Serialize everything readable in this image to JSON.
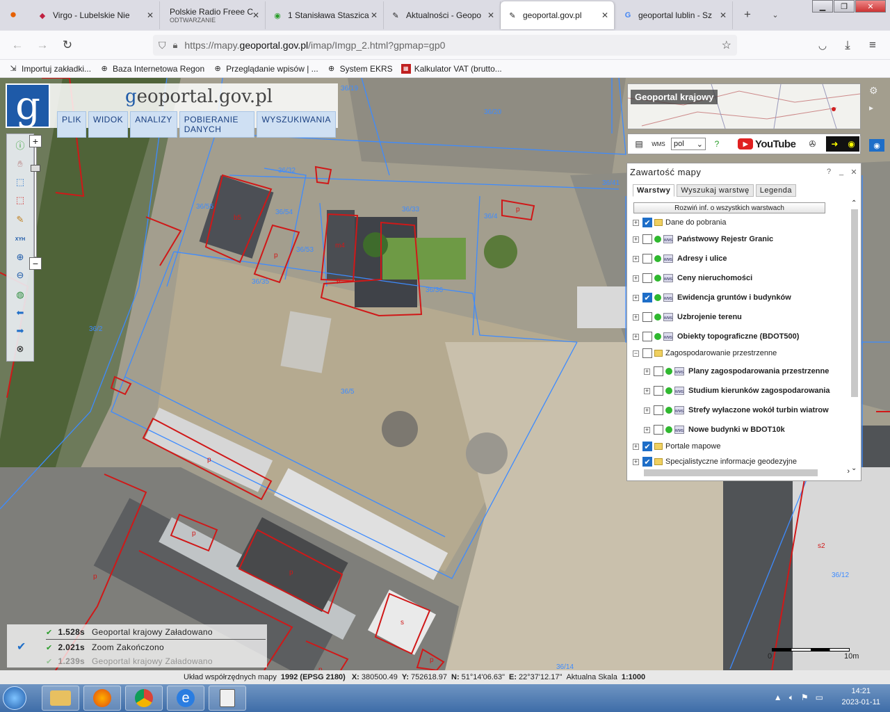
{
  "browser": {
    "tabs": [
      {
        "title": "Virgo - Lubelskie Nie",
        "icon": "virgo-icon"
      },
      {
        "title": "Polskie Radio Freee C",
        "subtitle": "ODTWARZANIE",
        "icon": ""
      },
      {
        "title": "1 Stanisława Staszica",
        "icon": "map-pin-icon"
      },
      {
        "title": "Aktualności - Geopo",
        "icon": "geoportal-icon"
      },
      {
        "title": "geoportal.gov.pl",
        "icon": "geoportal-icon"
      },
      {
        "title": "geoportal lublin - Sz",
        "icon": "google-icon"
      }
    ],
    "url_prefix": "https://mapy.",
    "url_domain": "geoportal.gov.pl",
    "url_suffix": "/imap/Imgp_2.html?gpmap=gp0",
    "bookmarks": [
      {
        "label": "Importuj zakładki...",
        "icon": "import-icon"
      },
      {
        "label": "Baza Internetowa Regon",
        "icon": "globe-icon"
      },
      {
        "label": "Przeglądanie wpisów | ...",
        "icon": "globe-icon"
      },
      {
        "label": "System EKRS",
        "icon": "globe-icon"
      },
      {
        "label": "Kalkulator VAT (brutto...",
        "icon": "vat-icon"
      }
    ]
  },
  "app": {
    "brand_prefix": "g",
    "brand_rest": "eoportal.gov.pl",
    "menu": [
      "PLIK",
      "WIDOK",
      "ANALIZY",
      "POBIERANIE DANYCH",
      "WYSZUKIWANIA"
    ],
    "minimap_label": "Geoportal krajowy",
    "language": "pol",
    "youtube_label": "YouTube"
  },
  "panel": {
    "title": "Zawartość mapy",
    "tabs": [
      "Warstwy",
      "Wyszukaj warstwę",
      "Legenda"
    ],
    "expand_label": "Rozwiń inf. o wszystkich warstwach",
    "layers": [
      {
        "label": "Dane do pobrania",
        "checked": true,
        "type": "folder",
        "indent": 0,
        "toggle": "+"
      },
      {
        "label": "Państwowy Rejestr Granic",
        "checked": false,
        "type": "wms",
        "indent": 0,
        "toggle": "+"
      },
      {
        "label": "Adresy i ulice",
        "checked": false,
        "type": "wms",
        "indent": 0,
        "toggle": "+"
      },
      {
        "label": "Ceny nieruchomości",
        "checked": false,
        "type": "wms",
        "indent": 0,
        "toggle": "+"
      },
      {
        "label": "Ewidencja gruntów i budynków",
        "checked": true,
        "type": "wms",
        "indent": 0,
        "toggle": "+"
      },
      {
        "label": "Uzbrojenie terenu",
        "checked": false,
        "type": "wms",
        "indent": 0,
        "toggle": "+"
      },
      {
        "label": "Obiekty topograficzne (BDOT500)",
        "checked": false,
        "type": "wms",
        "indent": 0,
        "toggle": "+"
      },
      {
        "label": "Zagospodarowanie przestrzenne",
        "checked": false,
        "type": "folder",
        "indent": 0,
        "toggle": "−"
      },
      {
        "label": "Plany zagospodarowania przestrzenne",
        "checked": false,
        "type": "wms",
        "indent": 1,
        "toggle": "+"
      },
      {
        "label": "Studium kierunków zagospodarowania",
        "checked": false,
        "type": "wms",
        "indent": 1,
        "toggle": "+"
      },
      {
        "label": "Strefy wyłaczone wokół turbin wiatrow",
        "checked": false,
        "type": "wms",
        "indent": 1,
        "toggle": "+"
      },
      {
        "label": "Nowe budynki w BDOT10k",
        "checked": false,
        "type": "wms",
        "indent": 1,
        "toggle": "+"
      },
      {
        "label": "Portale mapowe",
        "checked": true,
        "type": "folder",
        "indent": 0,
        "toggle": "+"
      },
      {
        "label": "Specjalistyczne informacje geodezyjne",
        "checked": true,
        "type": "folder",
        "indent": 0,
        "toggle": "+"
      }
    ]
  },
  "map": {
    "parcel_labels": [
      "36/19",
      "36/20",
      "36/32",
      "36/55",
      "36/54",
      "36/33",
      "36/53",
      "36/35",
      "36/36",
      "36/41",
      "36/2",
      "36/5",
      "36/4",
      "36/14",
      "36/12"
    ],
    "building_labels": [
      "b5",
      "p",
      "m4",
      "p",
      "p",
      "p",
      "p",
      "p",
      "p",
      "s",
      "p",
      "p",
      "s2"
    ],
    "status": [
      {
        "time": "1.528s",
        "text": "Geoportal krajowy  Załadowano"
      },
      {
        "time": "2.021s",
        "text": "Zoom  Zakończono"
      },
      {
        "time": "1.239s",
        "text": "Geoportal krajowy  Załadowano"
      }
    ],
    "scale_start": "0",
    "scale_end": "10m"
  },
  "coords": {
    "label": "Układ współrzędnych mapy",
    "system": "1992 (EPSG 2180)",
    "x_label": "X:",
    "x": "380500.49",
    "y_label": "Y:",
    "y": "752618.97",
    "n_label": "N:",
    "n": "51°14'06.63\"",
    "e_label": "E:",
    "e": "22°37'12.17\"",
    "scale_label": "Aktualna Skala",
    "scale": "1:1000"
  },
  "taskbar": {
    "apps": [
      "explorer-icon",
      "firefox-icon",
      "chrome-icon",
      "ie-icon",
      "docs-icon"
    ],
    "time": "14:21",
    "date": "2023-01-11"
  },
  "colors": {
    "accent": "#1e5aa8",
    "parcel_line": "#3d8bff",
    "building_line": "#d01818"
  }
}
